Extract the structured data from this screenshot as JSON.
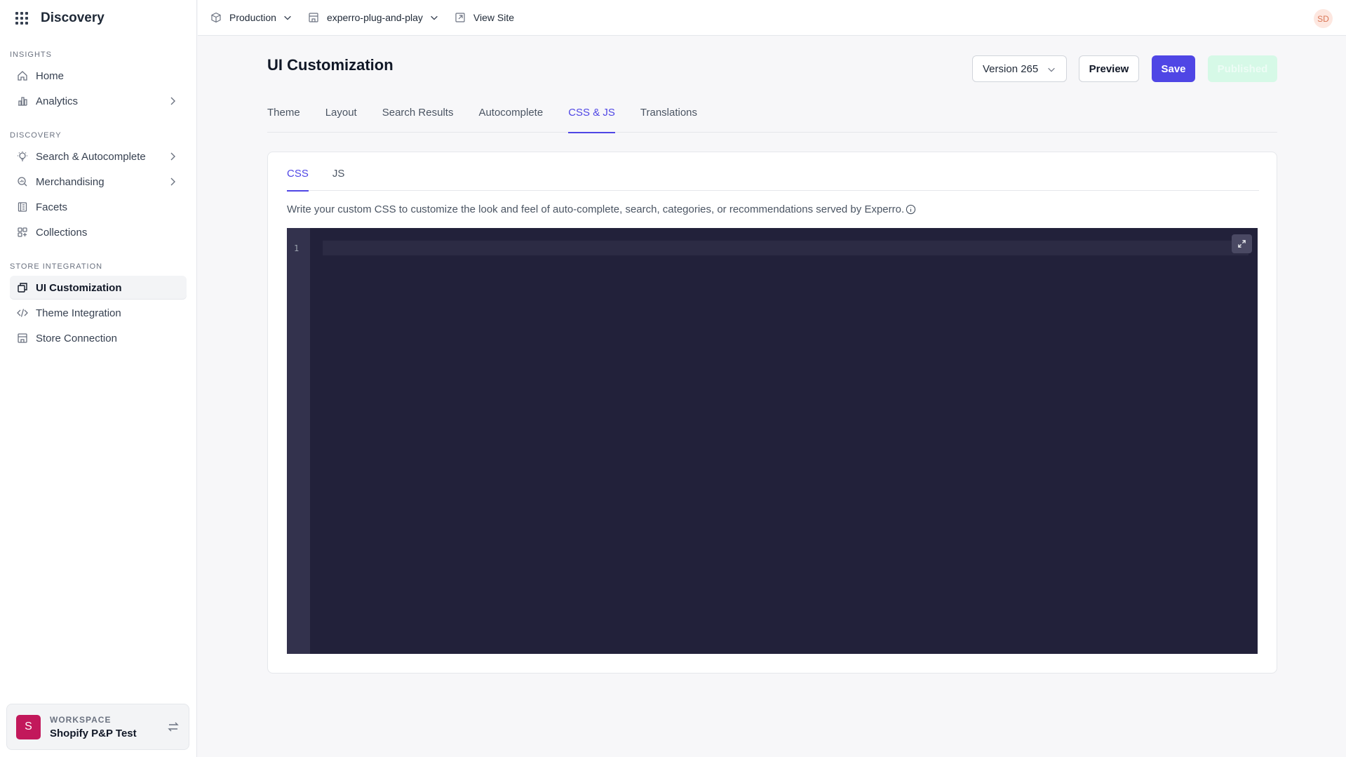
{
  "sidebar": {
    "brand": "Discovery",
    "sections": [
      {
        "label": "INSIGHTS",
        "items": [
          {
            "label": "Home"
          },
          {
            "label": "Analytics"
          }
        ]
      },
      {
        "label": "DISCOVERY",
        "items": [
          {
            "label": "Search & Autocomplete"
          },
          {
            "label": "Merchandising"
          },
          {
            "label": "Facets"
          },
          {
            "label": "Collections"
          }
        ]
      },
      {
        "label": "STORE INTEGRATION",
        "items": [
          {
            "label": "UI Customization"
          },
          {
            "label": "Theme Integration"
          },
          {
            "label": "Store Connection"
          }
        ]
      }
    ],
    "workspace": {
      "avatar": "S",
      "label": "WORKSPACE",
      "name": "Shopify P&P Test"
    }
  },
  "topbar": {
    "environment": "Production",
    "site": "experro-plug-and-play",
    "view_site": "View Site",
    "user_initials": "SD"
  },
  "page": {
    "title": "UI Customization",
    "version": "Version 265",
    "preview_label": "Preview",
    "save_label": "Save",
    "published_label": "Published",
    "tabs": [
      "Theme",
      "Layout",
      "Search Results",
      "Autocomplete",
      "CSS & JS",
      "Translations"
    ],
    "active_tab": "CSS & JS"
  },
  "editor_card": {
    "subtabs": [
      "CSS",
      "JS"
    ],
    "active_subtab": "CSS",
    "description": "Write your custom CSS to customize the look and feel of auto-complete, search, categories, or recommendations served by Experro.",
    "line_number": "1"
  },
  "colors": {
    "accent": "#4f46e5",
    "editor_bg": "#22213a",
    "workspace_avatar": "#c2185b",
    "published_bg": "#d1fae5"
  }
}
